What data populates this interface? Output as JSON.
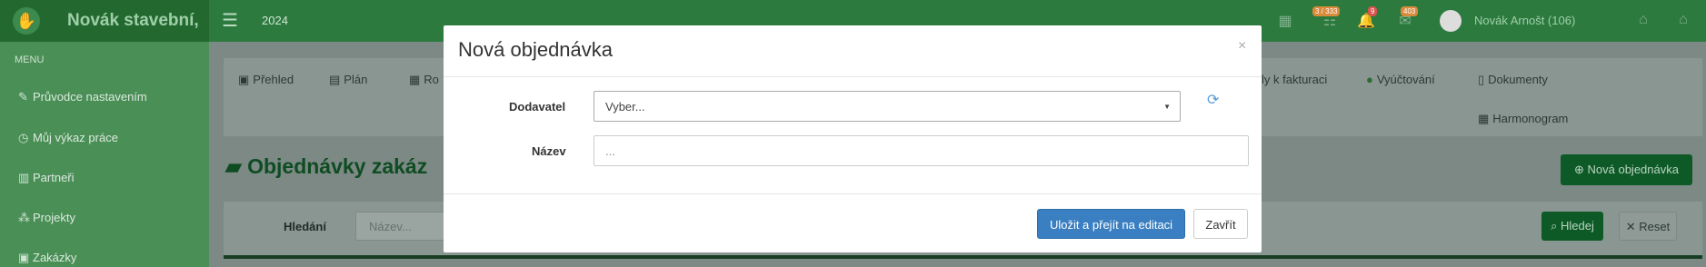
{
  "header": {
    "brand": "Novák stavební,",
    "year": "2024",
    "badges": {
      "tasks": "3 / 333",
      "notifications": "9",
      "messages": "403"
    },
    "user": "Novák Arnošt (106)"
  },
  "sidebar": {
    "menu_label": "MENU",
    "items": [
      {
        "label": "Průvodce nastavením",
        "icon": "pencil-icon"
      },
      {
        "label": "Můj výkaz práce",
        "icon": "clock-icon"
      },
      {
        "label": "Partneři",
        "icon": "building-icon"
      },
      {
        "label": "Projekty",
        "icon": "cubes-icon"
      },
      {
        "label": "Zakázky",
        "icon": "box-icon"
      }
    ]
  },
  "tabs": [
    {
      "label": "Přehled",
      "icon": "cube-icon"
    },
    {
      "label": "Plán",
      "icon": "calendar-icon"
    },
    {
      "label": "Ro",
      "icon": "budget-icon"
    },
    {
      "label": "ly k fakturaci",
      "icon": ""
    },
    {
      "label": "Vyúčtování",
      "icon": "check-circle-icon"
    },
    {
      "label": "Dokumenty",
      "icon": "file-icon"
    },
    {
      "label": "Harmonogram",
      "icon": "calendar-icon"
    }
  ],
  "page": {
    "title": "Objednávky zakáz",
    "new_button": "Nová objednávka"
  },
  "search": {
    "label": "Hledání",
    "placeholder": "Název...",
    "search_button": "Hledej",
    "reset_button": "Reset"
  },
  "modal": {
    "title": "Nová objednávka",
    "close_symbol": "×",
    "supplier_label": "Dodavatel",
    "supplier_value": "Vyber...",
    "name_label": "Název",
    "name_placeholder": "...",
    "save_button": "Uložit a přejít na editaci",
    "close_button": "Zavřít"
  },
  "colors": {
    "brand_green": "#2d7a3f",
    "primary_blue": "#3a7fc1",
    "dark_green_button": "#0e5a27"
  }
}
